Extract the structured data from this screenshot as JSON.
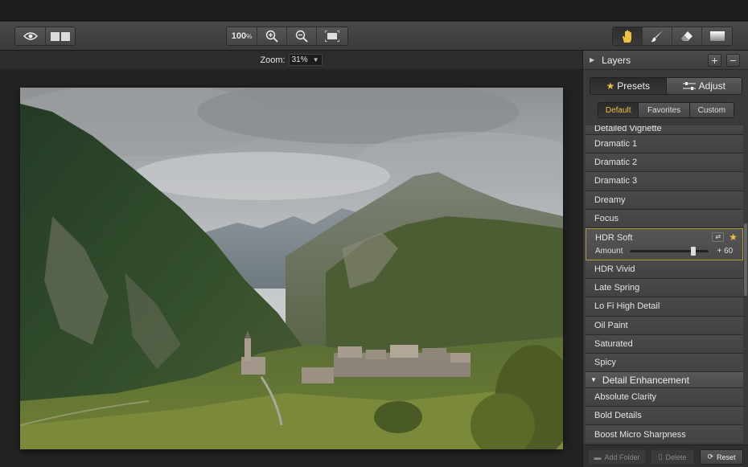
{
  "toolbar": {
    "zoom_percent": "100",
    "zoom_suffix": "%"
  },
  "zoombar": {
    "label": "Zoom:",
    "value": "31%"
  },
  "panel": {
    "layers_title": "Layers",
    "tabs": {
      "presets": "Presets",
      "adjust": "Adjust"
    },
    "subtabs": [
      "Default",
      "Favorites",
      "Custom"
    ],
    "presets_top": [
      "Detailed Vignette",
      "Dramatic 1",
      "Dramatic 2",
      "Dramatic 3",
      "Dreamy",
      "Focus"
    ],
    "selected": {
      "name": "HDR Soft",
      "amount_label": "Amount",
      "amount_value": "+ 60",
      "amount": 60
    },
    "presets_bottom": [
      "HDR Vivid",
      "Late Spring",
      "Lo Fi High Detail",
      "Oil Paint",
      "Saturated",
      "Spicy"
    ],
    "section": "Detail Enhancement",
    "section_items": [
      "Absolute Clarity",
      "Bold Details",
      "Boost Micro Sharpness"
    ],
    "footer": {
      "add_folder": "Add Folder",
      "delete": "Delete",
      "reset": "Reset"
    }
  },
  "colors": {
    "accent_gold": "#f0c040",
    "selection_border": "#b59a3a"
  }
}
